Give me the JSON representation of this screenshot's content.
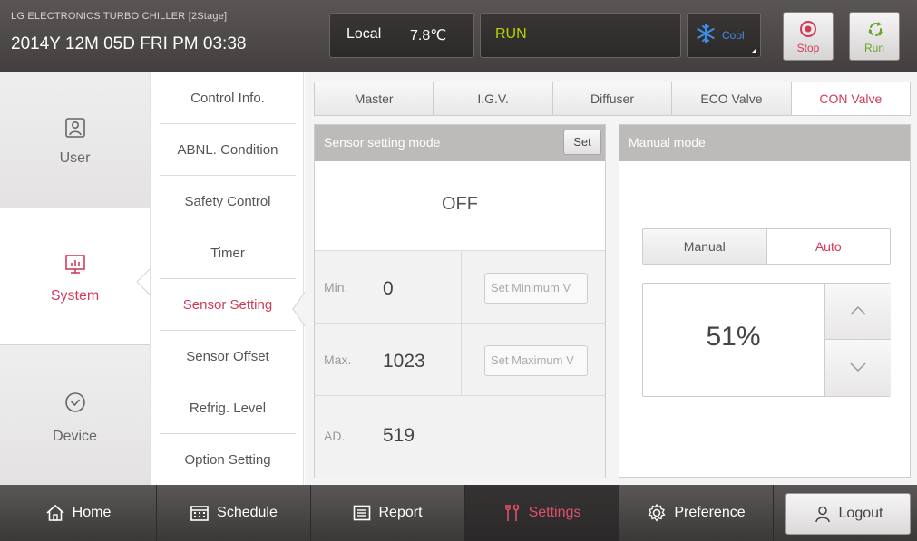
{
  "header": {
    "brand": "LG ELECTRONICS TURBO CHILLER [2Stage]",
    "datetime": "2014Y 12M 05D  FRI PM 03:38",
    "mode": "Local",
    "temperature": "7.8℃",
    "state": "RUN",
    "op_mode": "Cool",
    "stop_label": "Stop",
    "run_label": "Run",
    "colors": {
      "accent": "#d23b58",
      "run_green": "#b6d400",
      "cool_blue": "#3d8fe6"
    }
  },
  "left_nav": {
    "items": [
      {
        "label": "User",
        "icon": "user-frame-icon"
      },
      {
        "label": "System",
        "icon": "monitor-chart-icon",
        "active": true
      },
      {
        "label": "Device",
        "icon": "check-circle-icon"
      }
    ]
  },
  "submenu": {
    "items": [
      {
        "label": "Control Info."
      },
      {
        "label": "ABNL. Condition"
      },
      {
        "label": "Safety Control"
      },
      {
        "label": "Timer"
      },
      {
        "label": "Sensor Setting",
        "active": true
      },
      {
        "label": "Sensor Offset"
      },
      {
        "label": "Refrig. Level"
      },
      {
        "label": "Option Setting"
      }
    ]
  },
  "tabs": [
    {
      "label": "Master"
    },
    {
      "label": "I.G.V."
    },
    {
      "label": "Diffuser"
    },
    {
      "label": "ECO Valve"
    },
    {
      "label": "CON Valve",
      "active": true
    }
  ],
  "sensor_panel": {
    "title": "Sensor setting mode",
    "set_label": "Set",
    "status": "OFF",
    "min_label": "Min.",
    "min_value": "0",
    "min_button": "Set Minimum V",
    "max_label": "Max.",
    "max_value": "1023",
    "max_button": "Set Maximum V",
    "ad_label": "AD.",
    "ad_value": "519"
  },
  "manual_panel": {
    "title": "Manual mode",
    "manual_label": "Manual",
    "auto_label": "Auto",
    "selected": "Auto",
    "percent": "51%"
  },
  "bottom_nav": {
    "home": "Home",
    "schedule": "Schedule",
    "report": "Report",
    "settings": "Settings",
    "preference": "Preference",
    "logout": "Logout",
    "active": "Settings"
  }
}
